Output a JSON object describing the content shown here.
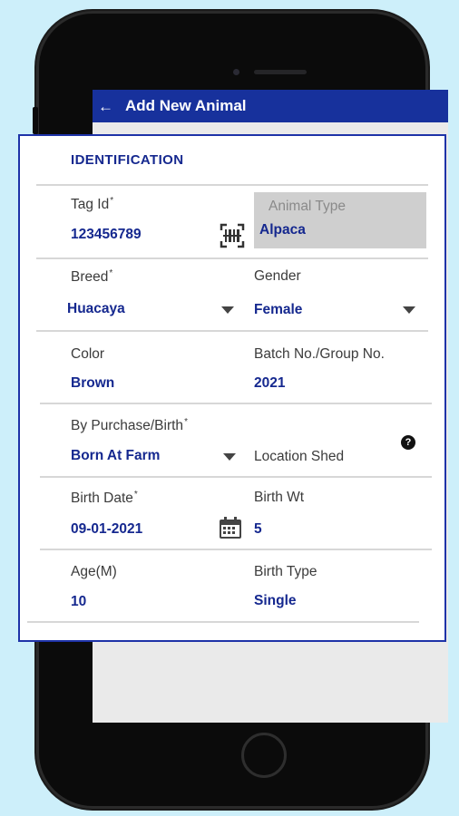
{
  "header": {
    "back_icon": "←",
    "title": "Add New Animal"
  },
  "section": {
    "title": "IDENTIFICATION"
  },
  "fields": {
    "tag_id": {
      "label": "Tag Id",
      "required": "*",
      "value": "123456789"
    },
    "animal_type": {
      "label": "Animal Type",
      "value": "Alpaca"
    },
    "breed": {
      "label": "Breed",
      "required": "*",
      "value": "Huacaya"
    },
    "gender": {
      "label": "Gender",
      "value": "Female"
    },
    "color": {
      "label": "Color",
      "value": "Brown"
    },
    "batch": {
      "label": "Batch No./Group No.",
      "value": "2021"
    },
    "purchase_birth": {
      "label": "By Purchase/Birth",
      "required": "*",
      "value": "Born At Farm"
    },
    "location_shed": {
      "label": "Location Shed",
      "help_icon": "?"
    },
    "birth_date": {
      "label": "Birth Date",
      "required": "*",
      "value": "09-01-2021"
    },
    "birth_wt": {
      "label": "Birth Wt",
      "value": "5"
    },
    "age": {
      "label": "Age(M)",
      "value": "10"
    },
    "birth_type": {
      "label": "Birth Type",
      "value": "Single"
    }
  },
  "icons": {
    "barcode": "barcode-scan-icon",
    "calendar": "calendar-icon",
    "dropdown": "chevron-down-icon",
    "help": "help-circle-icon"
  },
  "colors": {
    "brand": "#17319c",
    "value_text": "#15288f",
    "background": "#cdeffa",
    "readonly_field": "#cfcfcf"
  }
}
